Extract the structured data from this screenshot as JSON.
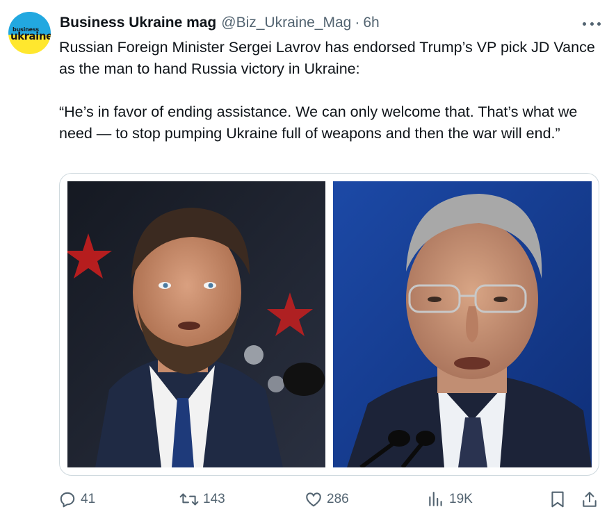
{
  "account": {
    "display_name": "Business Ukraine mag",
    "handle": "@Biz_Ukraine_Mag",
    "separator": "·",
    "time": "6h",
    "avatar_text_top": "business",
    "avatar_text_bottom": "ukraine"
  },
  "tweet": {
    "paragraph_1": "Russian Foreign Minister Sergei Lavrov has endorsed Trump’s VP pick JD Vance as the man to hand Russia victory in Ukraine:",
    "paragraph_2": "“He’s in favor of ending assistance. We can only welcome that. That’s what we need — to stop pumping Ukraine full of weapons and then the war will end.”"
  },
  "media": {
    "images": [
      {
        "subject": "man with beard in suit speaking at microphone, red stars background"
      },
      {
        "subject": "older man with glasses in suit speaking at microphone, blue background"
      }
    ]
  },
  "actions": {
    "replies": "41",
    "reposts": "143",
    "likes": "286",
    "views": "19K"
  },
  "colors": {
    "text": "#0f1419",
    "secondary": "#536471",
    "border": "#cfd9de"
  }
}
